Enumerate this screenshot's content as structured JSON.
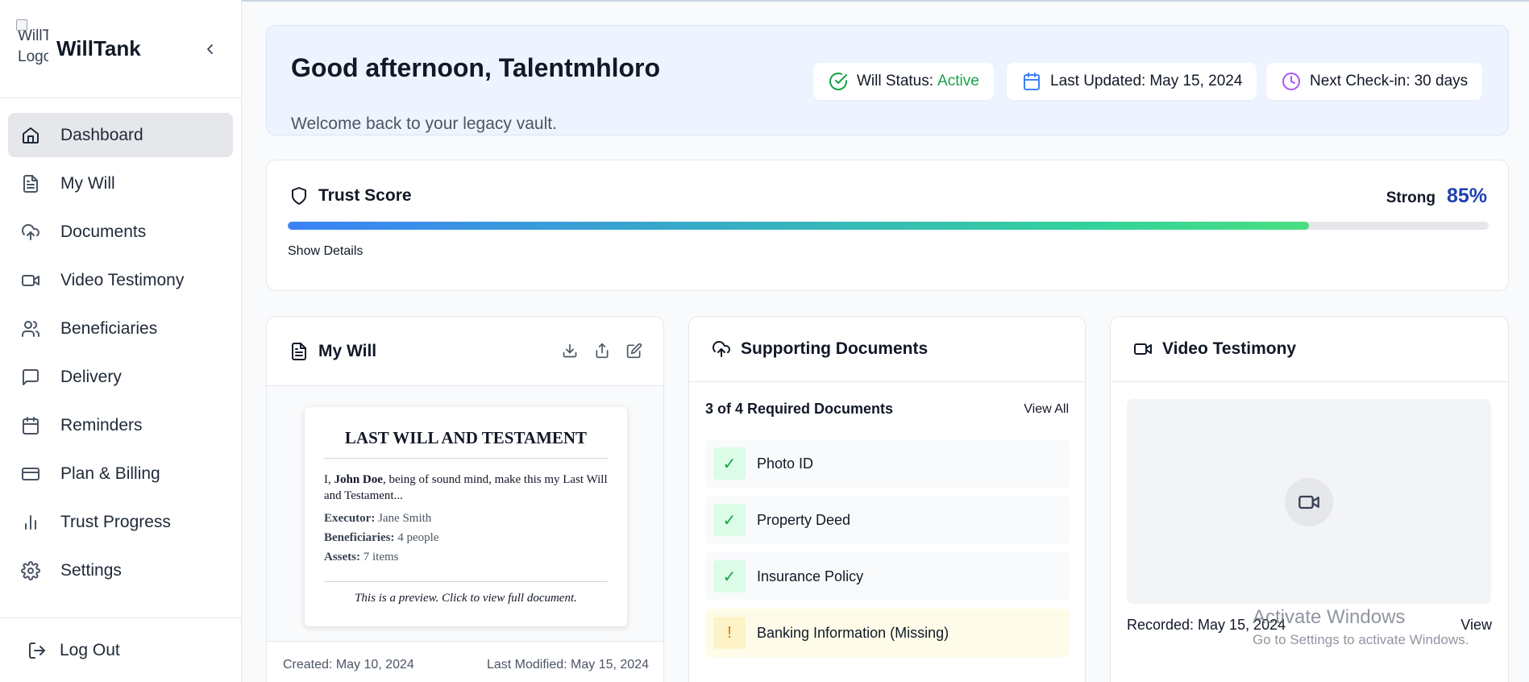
{
  "app": {
    "brand_name": "WillTank",
    "logo_alt": "WillTank Logo"
  },
  "sidebar": {
    "items": [
      {
        "label": "Dashboard",
        "icon": "home-icon"
      },
      {
        "label": "My Will",
        "icon": "file-text-icon"
      },
      {
        "label": "Documents",
        "icon": "cloud-upload-icon"
      },
      {
        "label": "Video Testimony",
        "icon": "video-icon"
      },
      {
        "label": "Beneficiaries",
        "icon": "users-icon"
      },
      {
        "label": "Delivery",
        "icon": "message-square-icon"
      },
      {
        "label": "Reminders",
        "icon": "calendar-icon"
      },
      {
        "label": "Plan & Billing",
        "icon": "credit-card-icon"
      },
      {
        "label": "Trust Progress",
        "icon": "bar-chart-icon"
      },
      {
        "label": "Settings",
        "icon": "gear-icon"
      }
    ],
    "active": "Dashboard",
    "logout_label": "Log Out"
  },
  "greeting": {
    "title": "Good afternoon, Talentmhloro",
    "subtitle": "Welcome back to your legacy vault.",
    "will_status_label": "Will Status:",
    "will_status_value": "Active",
    "last_updated_label": "Last Updated:",
    "last_updated_value": "May 15, 2024",
    "next_checkin_label": "Next Check-in:",
    "next_checkin_value": "30 days"
  },
  "trust_score": {
    "title": "Trust Score",
    "strength_label": "Strong",
    "percent_text": "85%",
    "percent": 85,
    "show_details": "Show Details"
  },
  "my_will": {
    "title": "My Will",
    "doc_title": "LAST WILL AND TESTAMENT",
    "intro_prefix": "I,",
    "intro_name": "John Doe",
    "intro_suffix": ", being of sound mind, make this my Last Will and Testament...",
    "executor_label": "Executor:",
    "executor_value": "Jane Smith",
    "beneficiaries_label": "Beneficiaries:",
    "beneficiaries_value": "4 people",
    "assets_label": "Assets:",
    "assets_value": "7 items",
    "preview_note": "This is a preview. Click to view full document.",
    "created": "Created: May 10, 2024",
    "last_modified": "Last Modified: May 15, 2024"
  },
  "supporting_documents": {
    "title": "Supporting Documents",
    "summary": "3 of 4 Required Documents",
    "view_all": "View All",
    "items": [
      {
        "label": "Photo ID",
        "status": "complete",
        "mark": "✓"
      },
      {
        "label": "Property Deed",
        "status": "complete",
        "mark": "✓"
      },
      {
        "label": "Insurance Policy",
        "status": "complete",
        "mark": "✓"
      },
      {
        "label": "Banking Information (Missing)",
        "status": "missing",
        "mark": "!"
      }
    ]
  },
  "video_testimony": {
    "title": "Video Testimony",
    "recorded": "Recorded: May 15, 2024",
    "view": "View"
  },
  "watermark": {
    "line1": "Activate Windows",
    "line2": "Go to Settings to activate Windows."
  },
  "colors": {
    "accent_blue": "#1e40af",
    "status_green": "#16a34a",
    "warning_amber": "#d97706",
    "checkin_purple": "#a855f7"
  }
}
